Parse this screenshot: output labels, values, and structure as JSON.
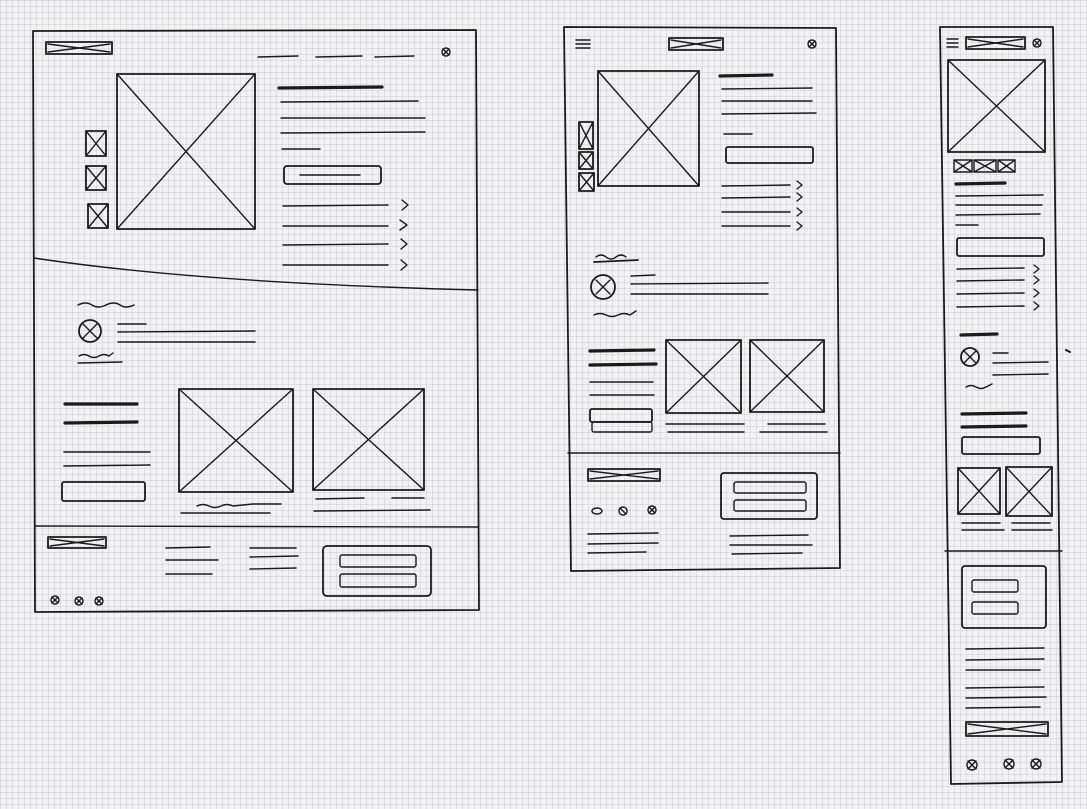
{
  "sketch": {
    "ink_color": "#1b1b1b",
    "paper_color": "#f2f2f4",
    "grid_color": "#a0aab8",
    "frames": [
      {
        "name": "desktop",
        "sections": [
          "header",
          "product-hero",
          "reviews-and-related",
          "footer"
        ]
      },
      {
        "name": "tablet",
        "sections": [
          "header",
          "product-hero",
          "reviews-and-related",
          "footer"
        ]
      },
      {
        "name": "mobile",
        "sections": [
          "header",
          "product-hero",
          "reviews-and-related",
          "footer"
        ]
      }
    ],
    "icons": [
      "hamburger-icon",
      "cart-icon",
      "image-placeholder-icon",
      "avatar-icon",
      "chevron-right-icon",
      "social-icon"
    ]
  }
}
